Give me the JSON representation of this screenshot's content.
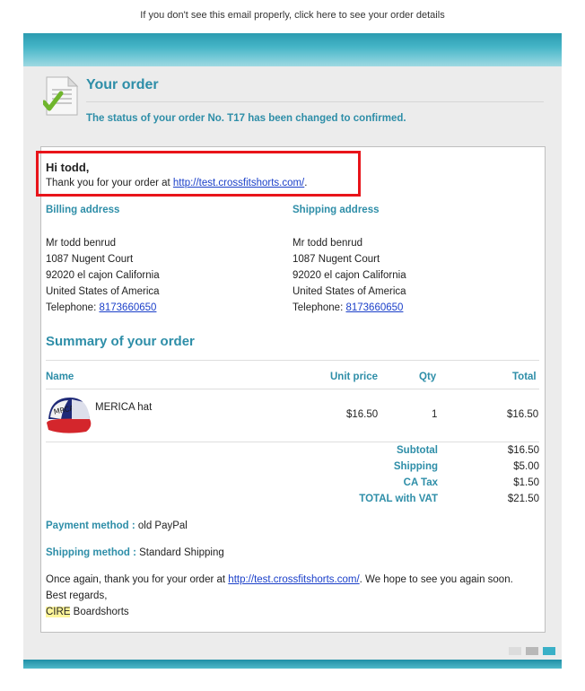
{
  "topnote": "If you don't see this email properly, click here to see your order details",
  "header": {
    "title": "Your order",
    "status": "The status of your order No. T17 has been changed to confirmed."
  },
  "greeting": {
    "hi": "Hi todd,",
    "thank_prefix": "Thank you for your order at ",
    "link": "http://test.crossfitshorts.com/",
    "thank_suffix": "."
  },
  "billing": {
    "label": "Billing address",
    "name": "Mr todd benrud",
    "street": "1087 Nugent Court",
    "city": "92020 el cajon California",
    "country": "United States of America",
    "tel_label": "Telephone: ",
    "tel": "8173660650"
  },
  "shipping": {
    "label": "Shipping address",
    "name": "Mr todd benrud",
    "street": "1087 Nugent Court",
    "city": "92020 el cajon California",
    "country": "United States of America",
    "tel_label": "Telephone: ",
    "tel": "8173660650"
  },
  "summary": {
    "title": "Summary of your order",
    "columns": {
      "name": "Name",
      "unit_price": "Unit price",
      "qty": "Qty",
      "total": "Total"
    },
    "item": {
      "name": "MERICA hat",
      "unit_price": "$16.50",
      "qty": "1",
      "total": "$16.50"
    },
    "totals": [
      {
        "label": "Subtotal",
        "value": "$16.50"
      },
      {
        "label": "Shipping",
        "value": "$5.00"
      },
      {
        "label": "CA Tax",
        "value": "$1.50"
      },
      {
        "label": "TOTAL with VAT",
        "value": "$21.50"
      }
    ]
  },
  "payment": {
    "label": "Payment method :",
    "value": " old PayPal"
  },
  "shipping_method": {
    "label": "Shipping method :",
    "value": " Standard Shipping"
  },
  "closing": {
    "prefix": "Once again, thank you for your order at ",
    "link": "http://test.crossfitshorts.com/",
    "suffix": ". We hope to see you again soon.",
    "regards": "Best regards,",
    "brand_highlight": "CIRE",
    "brand_rest": " Boardshorts"
  },
  "colors": {
    "accent": "#2e8ea8",
    "highlight_box": "#e8141a",
    "link": "#1a3fc9"
  },
  "icons": {
    "header_icon": "document-check-icon",
    "product": "hat-thumbnail"
  }
}
